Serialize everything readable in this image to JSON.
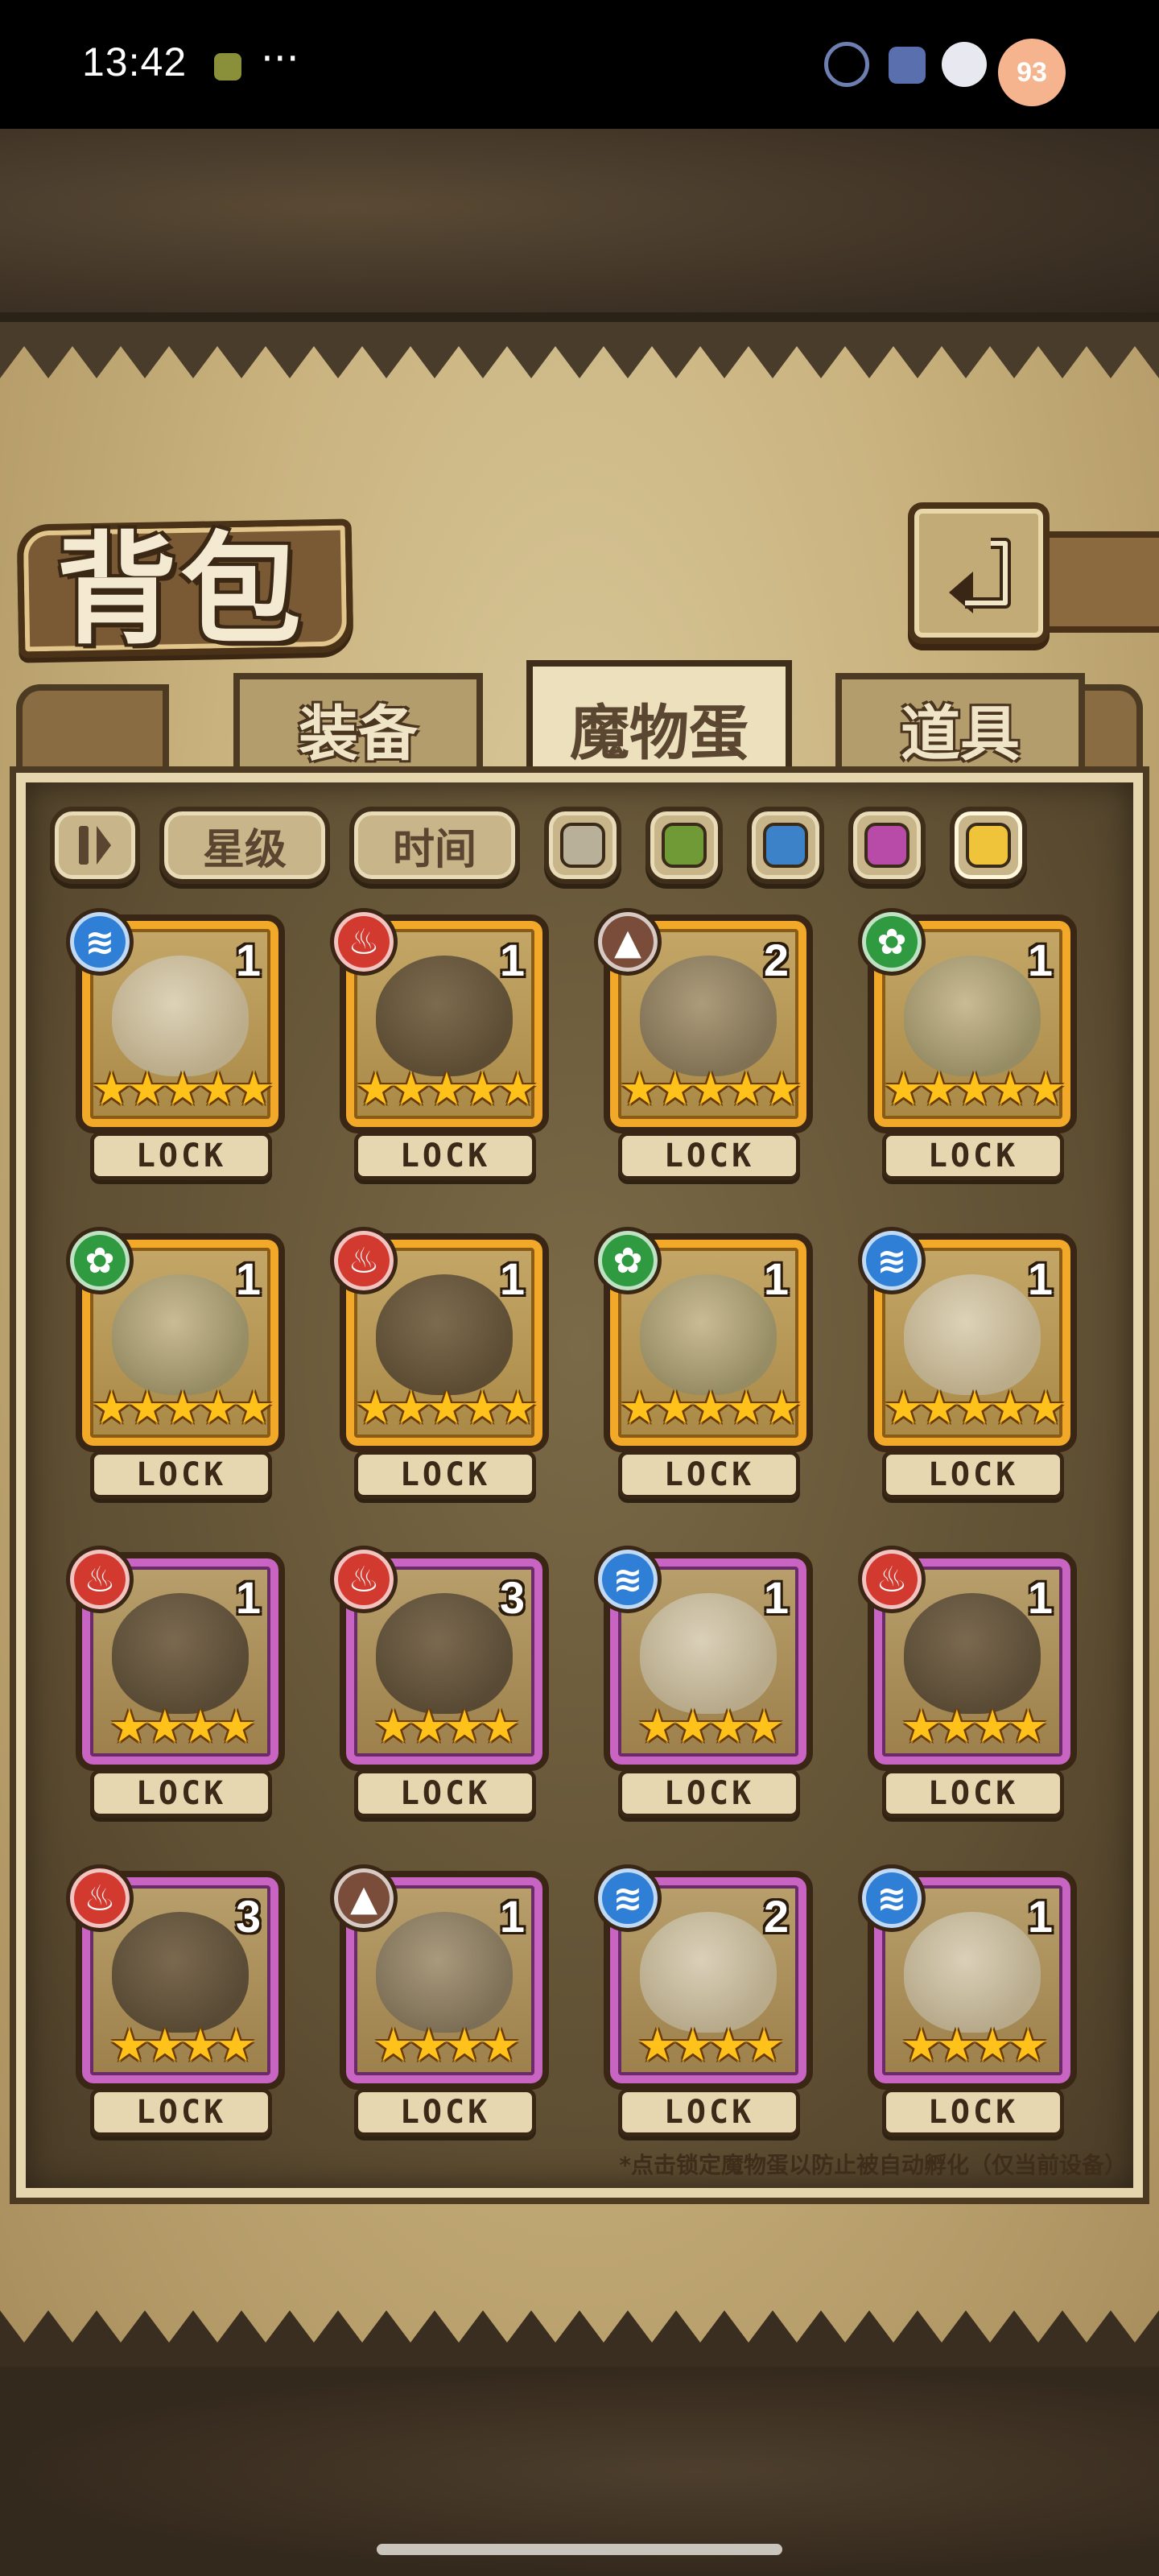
{
  "status_bar": {
    "time": "13:42",
    "more": "···",
    "battery_badge": "93"
  },
  "header": {
    "title": "背包",
    "back_icon": "back-arrow-icon"
  },
  "tabs": [
    {
      "label": "装备",
      "active": false
    },
    {
      "label": "魔物蛋",
      "active": true
    },
    {
      "label": "道具",
      "active": false
    }
  ],
  "filters": {
    "sort_icon": "sort-toggle-icon",
    "star_label": "星级",
    "time_label": "时间",
    "rarity_colors": [
      "#b9b09a",
      "#6f9a36",
      "#3b82c8",
      "#b84aa8",
      "#f0c43a"
    ]
  },
  "element_colors": {
    "water": "#2f7fd6",
    "fire": "#d33a2f",
    "earth": "#7a4d3a",
    "nature": "#2f9a3f"
  },
  "eggs": [
    {
      "element": "water",
      "count": "1",
      "stars": "★★★★★",
      "rarity": "gold",
      "lock": "LOCK"
    },
    {
      "element": "fire",
      "count": "1",
      "stars": "★★★★★",
      "rarity": "gold",
      "lock": "LOCK"
    },
    {
      "element": "earth",
      "count": "2",
      "stars": "★★★★★",
      "rarity": "gold",
      "lock": "LOCK"
    },
    {
      "element": "nature",
      "count": "1",
      "stars": "★★★★★",
      "rarity": "gold",
      "lock": "LOCK"
    },
    {
      "element": "nature",
      "count": "1",
      "stars": "★★★★★",
      "rarity": "gold",
      "lock": "LOCK"
    },
    {
      "element": "fire",
      "count": "1",
      "stars": "★★★★★",
      "rarity": "gold",
      "lock": "LOCK"
    },
    {
      "element": "nature",
      "count": "1",
      "stars": "★★★★★",
      "rarity": "gold",
      "lock": "LOCK"
    },
    {
      "element": "water",
      "count": "1",
      "stars": "★★★★★",
      "rarity": "gold",
      "lock": "LOCK"
    },
    {
      "element": "fire",
      "count": "1",
      "stars": "★★★★",
      "rarity": "purple",
      "lock": "LOCK"
    },
    {
      "element": "fire",
      "count": "3",
      "stars": "★★★★",
      "rarity": "purple",
      "lock": "LOCK"
    },
    {
      "element": "water",
      "count": "1",
      "stars": "★★★★",
      "rarity": "purple",
      "lock": "LOCK"
    },
    {
      "element": "fire",
      "count": "1",
      "stars": "★★★★",
      "rarity": "purple",
      "lock": "LOCK"
    },
    {
      "element": "fire",
      "count": "3",
      "stars": "★★★★",
      "rarity": "purple",
      "lock": "LOCK"
    },
    {
      "element": "earth",
      "count": "1",
      "stars": "★★★★",
      "rarity": "purple",
      "lock": "LOCK"
    },
    {
      "element": "water",
      "count": "2",
      "stars": "★★★★",
      "rarity": "purple",
      "lock": "LOCK"
    },
    {
      "element": "water",
      "count": "1",
      "stars": "★★★★",
      "rarity": "purple",
      "lock": "LOCK"
    }
  ],
  "hint": "*点击锁定魔物蛋以防止被自动孵化（仅当前设备）"
}
